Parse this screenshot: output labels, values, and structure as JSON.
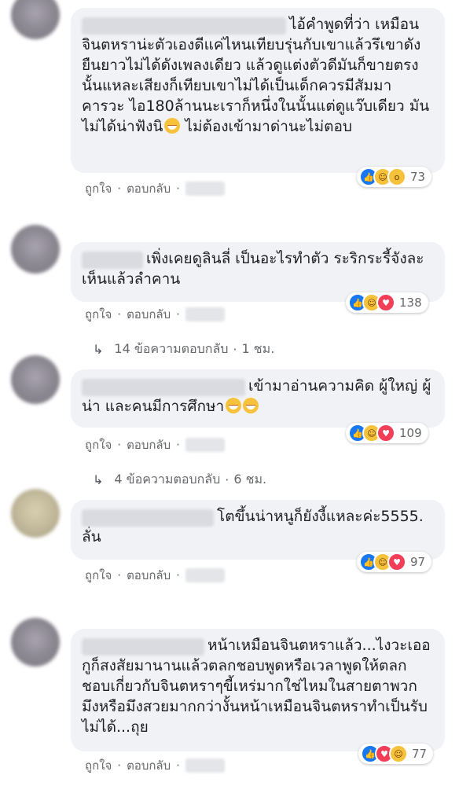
{
  "actions": {
    "like": "ถูกใจ",
    "reply": "ตอบกลับ",
    "dot": "·"
  },
  "comments": [
    {
      "text": "ไอ้คำพูดที่ว่า เหมือนจินตหราน่ะตัวเองดีแค่ไหนเทียบรุ่นกับเขาแล้วรึเขาดังยืนยาวไม่ได้ดังเพลงเดียว แล้วดูแต่งตัวดีมันก็ขายตรงนั้นแหละเสียงก็เทียบเขาไม่ได้เป็นเด็กควรมีสัมมาคารวะ ไอ180ล้านนะเราก็หนึ่งในนั้นแต่ดูแว๊บเดียว มันไม่ได้น่าฟังนิ",
      "text_after_emoji": " ไม่ต้องเข้ามาด่านะไม่ตอบ",
      "reactions": [
        "like",
        "haha",
        "wow"
      ],
      "reaction_count": "73"
    },
    {
      "text": "เพิ่งเคยดูลินลี่ เป็นอะไรทำตัว ระริกระรี้จังละ เห็นแล้วลำคาน",
      "reactions": [
        "like",
        "haha",
        "love"
      ],
      "reaction_count": "138",
      "replies": {
        "text": "14 ข้อความตอบกลับ",
        "time": "1 ชม."
      }
    },
    {
      "text": "เข้ามาอ่านความคิด ผู้ใหญ่ ผู้น่า และคนมีการศึกษา",
      "reactions": [
        "like",
        "haha",
        "love"
      ],
      "reaction_count": "109",
      "replies": {
        "text": "4 ข้อความตอบกลับ",
        "time": "6 ชม."
      }
    },
    {
      "text": "โตขึ้นน่าหนูก็ยังงี้แหละค่ะ5555. ลั่น",
      "reactions": [
        "like",
        "haha",
        "love"
      ],
      "reaction_count": "97"
    },
    {
      "text": "หน้าเหมือนจินตหราแล้ว...ไงวะเออกูก็สงสัยมานานแล้วตลกชอบพูดหรือเวลาพูดให้ตลกชอบเกี่ยวกับจินตหราๆขี้เหร่มากใช่ไหมในสายตาพวกมึงหรือมึงสวยมากกว่างั้นหน้าเหมือนจินตหราทำเป็นรับไม่ได้...ถุย",
      "reactions": [
        "like",
        "love",
        "haha"
      ],
      "reaction_count": "77"
    }
  ]
}
